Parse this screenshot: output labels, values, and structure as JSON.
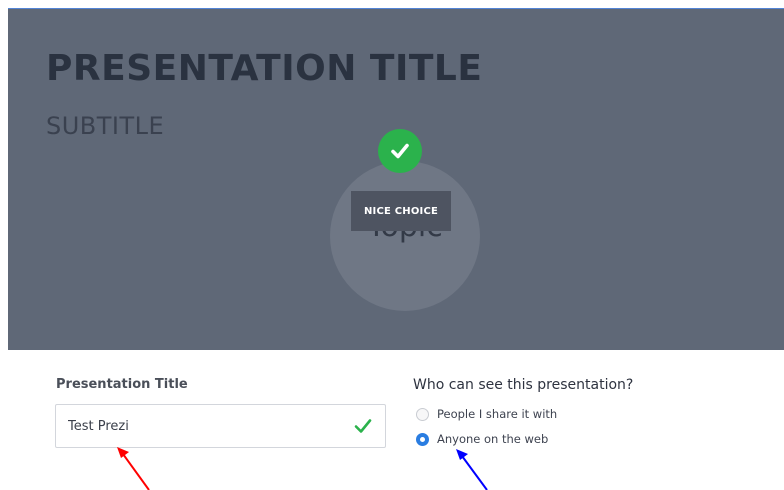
{
  "preview": {
    "title": "PRESENTATION TITLE",
    "subtitle": "SUBTITLE",
    "topic": "Topic",
    "tooltip": "NICE CHOICE"
  },
  "form": {
    "title_label": "Presentation Title",
    "title_value": "Test Prezi",
    "privacy_heading": "Who can see this presentation?",
    "privacy_options": [
      {
        "label": "People I share it with",
        "selected": false
      },
      {
        "label": "Anyone on the web",
        "selected": true
      }
    ]
  },
  "colors": {
    "preview_background": "#5f6877",
    "success_green": "#2bb24c",
    "radio_selected": "#2a7de1",
    "red_arrow": "#ff0000",
    "blue_arrow": "#0000ff"
  },
  "icons": {
    "check_badge": "check-icon",
    "input_valid": "check-icon",
    "annotation_left": "red-arrow",
    "annotation_right": "blue-arrow"
  }
}
